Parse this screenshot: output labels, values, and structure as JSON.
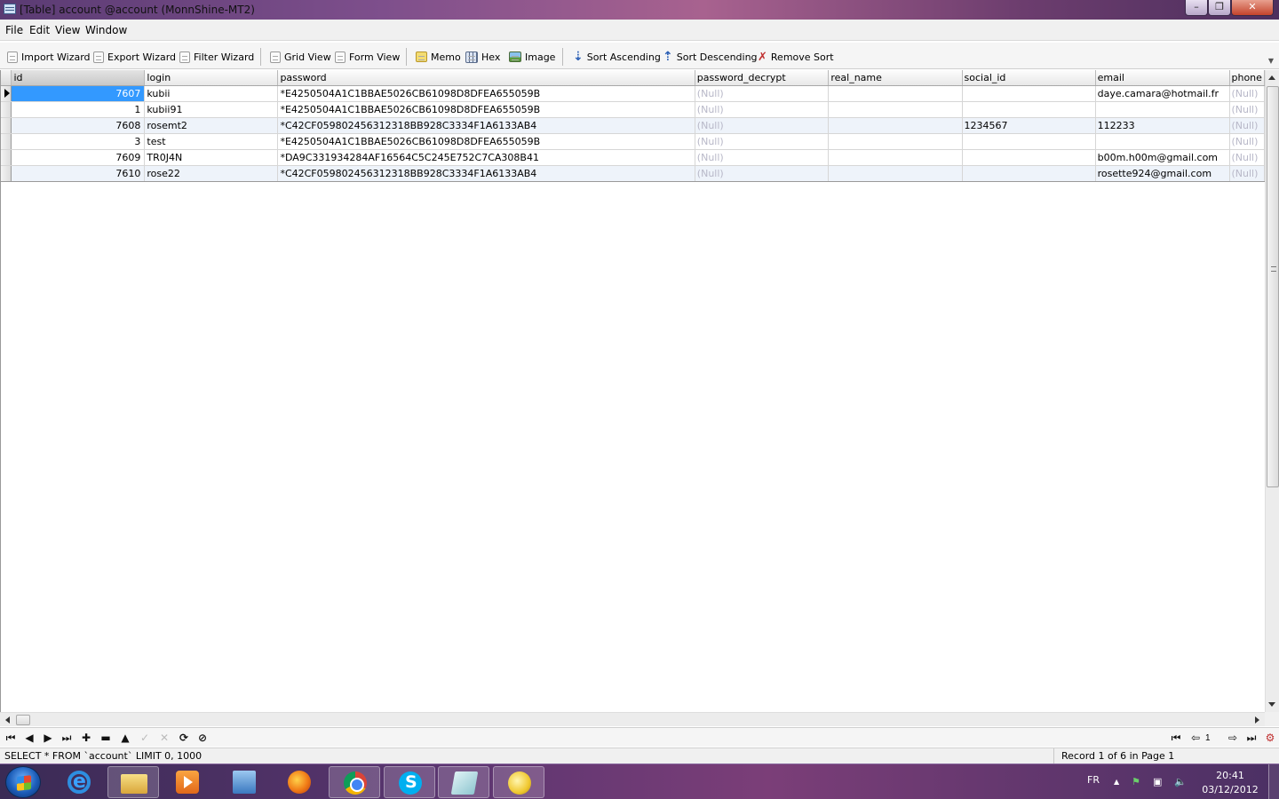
{
  "window": {
    "title": "[Table] account @account (MonnShine-MT2)"
  },
  "menu": [
    "File",
    "Edit",
    "View",
    "Window"
  ],
  "toolbar": {
    "import_wizard": "Import Wizard",
    "export_wizard": "Export Wizard",
    "filter_wizard": "Filter Wizard",
    "grid_view": "Grid View",
    "form_view": "Form View",
    "memo": "Memo",
    "hex": "Hex",
    "image": "Image",
    "sort_ascending": "Sort Ascending",
    "sort_descending": "Sort Descending",
    "remove_sort": "Remove Sort"
  },
  "grid": {
    "columns": [
      "id",
      "login",
      "password",
      "password_decrypt",
      "real_name",
      "social_id",
      "email",
      "phone"
    ],
    "null_text": "(Null)",
    "rows": [
      {
        "id": "7607",
        "login": "kubii",
        "password": "*E4250504A1C1BBAE5026CB61098D8DFEA655059B",
        "password_decrypt": "(Null)",
        "real_name": "",
        "social_id": "",
        "email": "daye.camara@hotmail.fr",
        "phone": "(Null)"
      },
      {
        "id": "1",
        "login": "kubii91",
        "password": "*E4250504A1C1BBAE5026CB61098D8DFEA655059B",
        "password_decrypt": "(Null)",
        "real_name": "",
        "social_id": "",
        "email": "",
        "phone": "(Null)"
      },
      {
        "id": "7608",
        "login": "rosemt2",
        "password": "*C42CF059802456312318BB928C3334F1A6133AB4",
        "password_decrypt": "(Null)",
        "real_name": "",
        "social_id": "1234567",
        "email": "112233",
        "phone": "(Null)"
      },
      {
        "id": "3",
        "login": "test",
        "password": "*E4250504A1C1BBAE5026CB61098D8DFEA655059B",
        "password_decrypt": "(Null)",
        "real_name": "",
        "social_id": "",
        "email": "",
        "phone": "(Null)"
      },
      {
        "id": "7609",
        "login": "TR0J4N",
        "password": "*DA9C331934284AF16564C5C245E752C7CA308B41",
        "password_decrypt": "(Null)",
        "real_name": "",
        "social_id": "",
        "email": "b00m.h00m@gmail.com",
        "phone": "(Null)"
      },
      {
        "id": "7610",
        "login": "rose22",
        "password": "*C42CF059802456312318BB928C3334F1A6133AB4",
        "password_decrypt": "(Null)",
        "real_name": "",
        "social_id": "",
        "email": "rosette924@gmail.com",
        "phone": "(Null)"
      }
    ]
  },
  "navigation": {
    "page_number": "1"
  },
  "status": {
    "sql": "SELECT * FROM `account` LIMIT 0, 1000",
    "record": "Record 1 of 6 in Page 1"
  },
  "taskbar": {
    "language": "FR",
    "time": "20:41",
    "date": "03/12/2012"
  },
  "colors": {
    "selection": "#3399ff",
    "null_text": "#b8b8c8"
  }
}
